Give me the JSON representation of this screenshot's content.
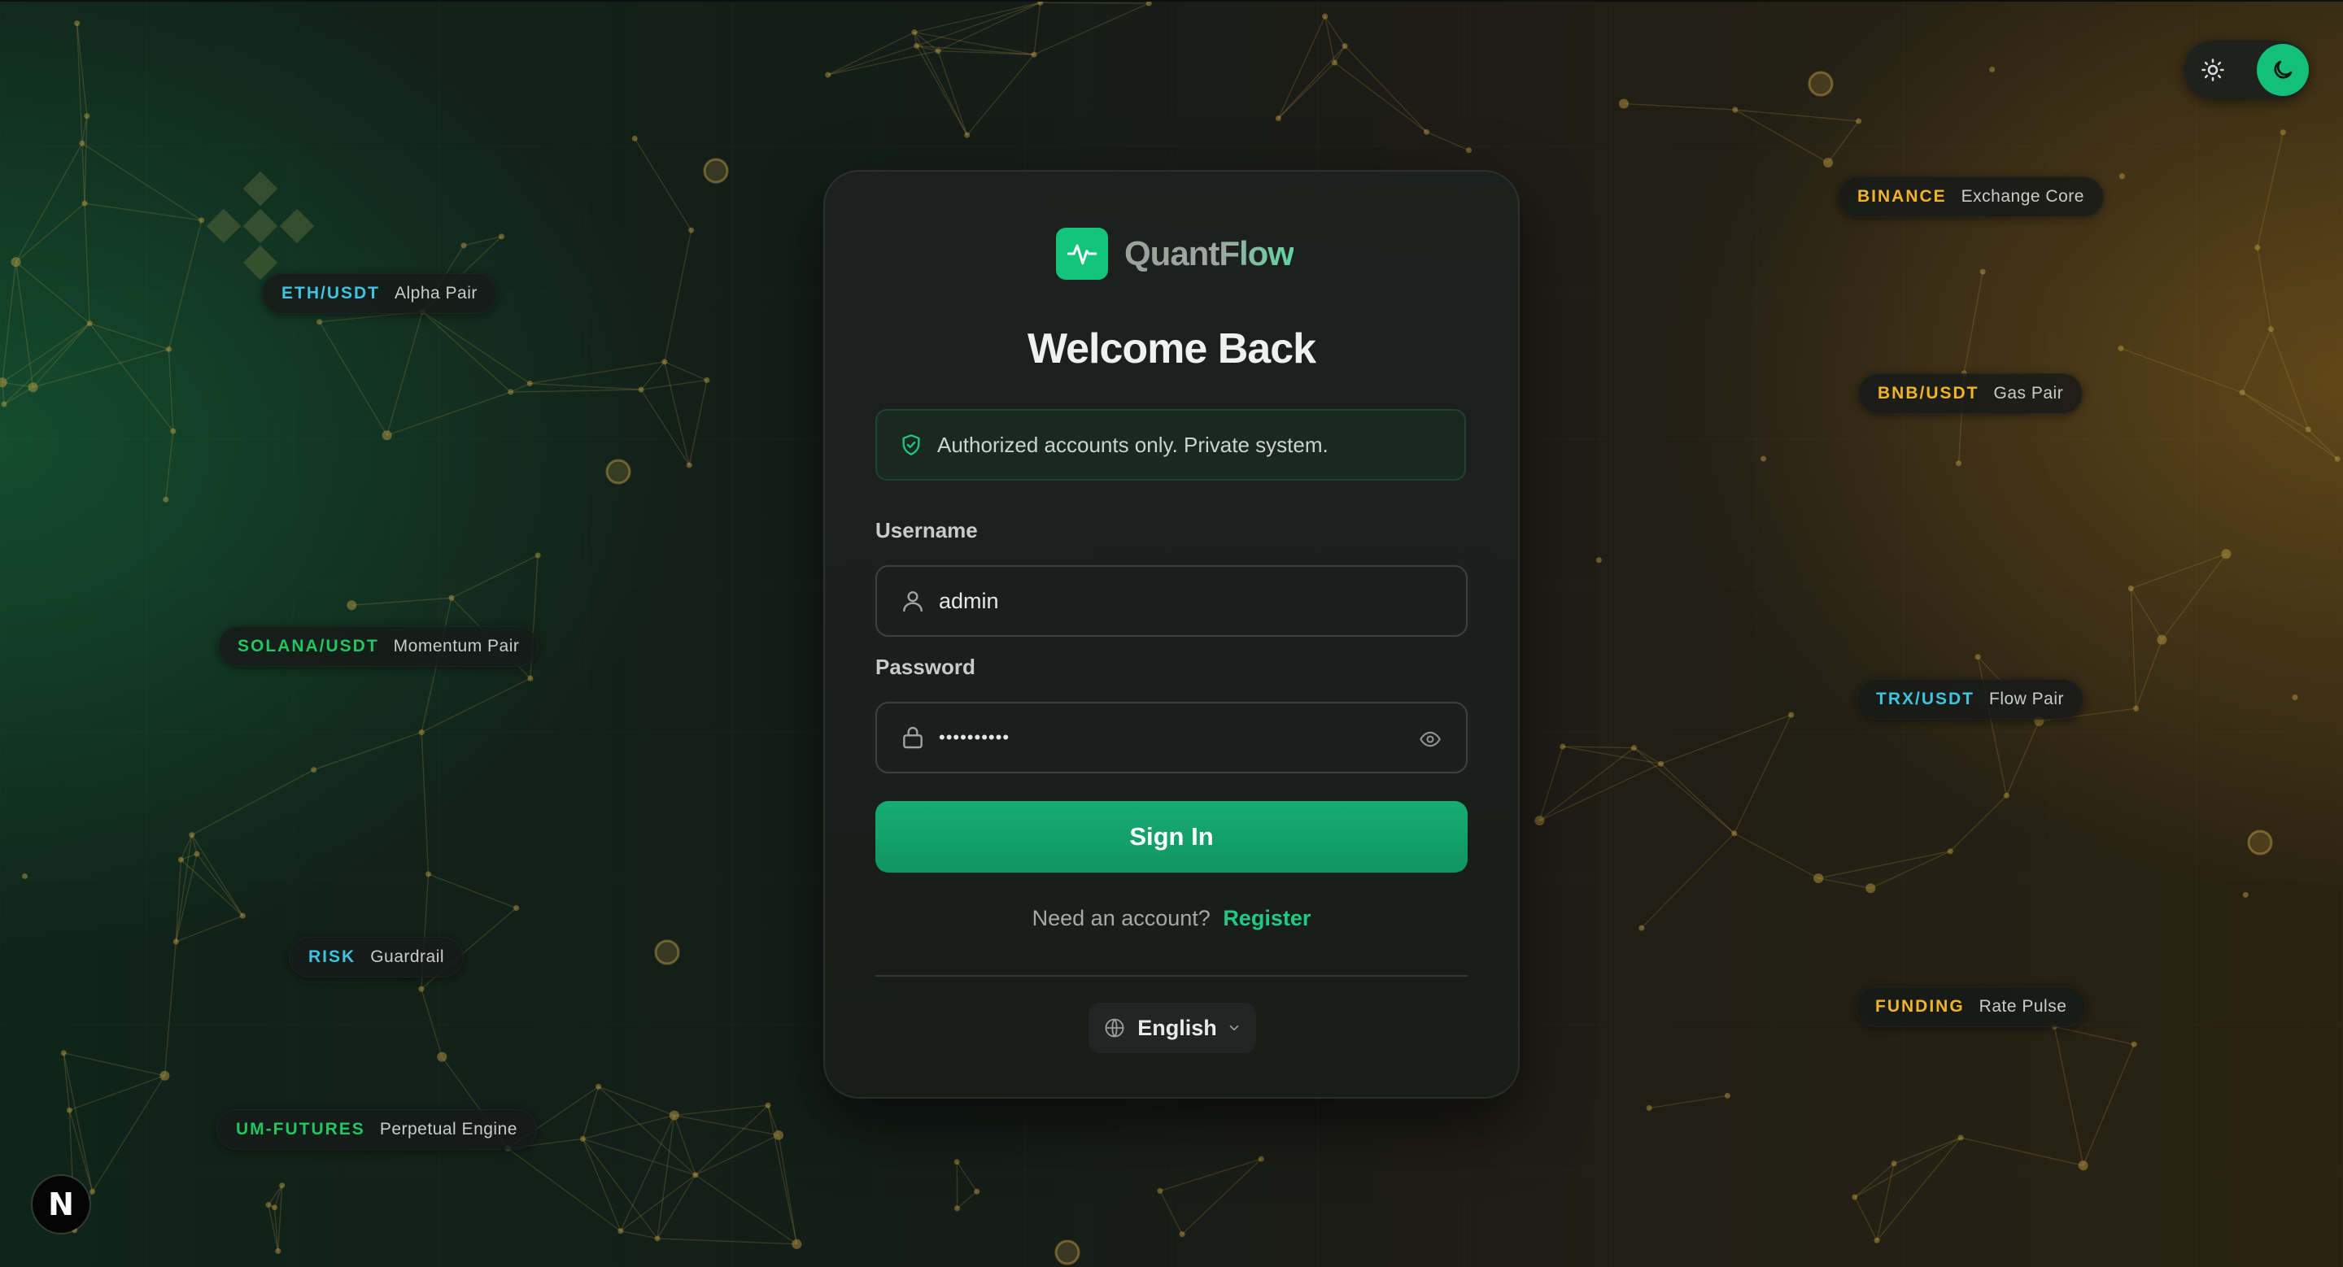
{
  "app": {
    "name": "QuantFlow"
  },
  "theme_toggle": {
    "light_icon": "sun-icon",
    "dark_icon": "moon-icon",
    "active": "dark"
  },
  "tags": {
    "eth": {
      "symbol": "ETH/USDT",
      "desc": "Alpha Pair",
      "color": "#3ec3e0"
    },
    "solana": {
      "symbol": "SOLANA/USDT",
      "desc": "Momentum Pair",
      "color": "#22c55e"
    },
    "risk": {
      "symbol": "RISK",
      "desc": "Guardrail",
      "color": "#3ec3e0"
    },
    "umfutures": {
      "symbol": "UM-FUTURES",
      "desc": "Perpetual Engine",
      "color": "#22c55e"
    },
    "binance": {
      "symbol": "BINANCE",
      "desc": "Exchange Core",
      "color": "#f0b429"
    },
    "bnb": {
      "symbol": "BNB/USDT",
      "desc": "Gas Pair",
      "color": "#f0b429"
    },
    "trx": {
      "symbol": "TRX/USDT",
      "desc": "Flow Pair",
      "color": "#3ec3e0"
    },
    "funding": {
      "symbol": "FUNDING",
      "desc": "Rate Pulse",
      "color": "#f0b429"
    }
  },
  "login": {
    "title": "Welcome Back",
    "notice": "Authorized accounts only. Private system.",
    "username_label": "Username",
    "username_value": "admin",
    "password_label": "Password",
    "password_value": "••••••••••",
    "signin_label": "Sign In",
    "register_prompt": "Need an account?",
    "register_link": "Register",
    "language": "English"
  },
  "colors": {
    "accent": "#12c079",
    "gold": "#c9a13a"
  },
  "badge": {
    "label": "N"
  }
}
